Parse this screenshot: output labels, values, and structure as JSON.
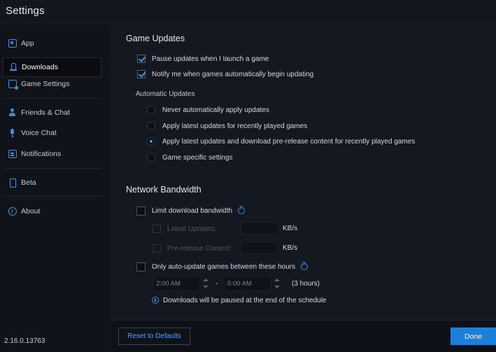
{
  "window": {
    "title": "Settings"
  },
  "sidebar": {
    "items": [
      {
        "label": "App",
        "icon": "app-icon"
      },
      {
        "label": "Downloads",
        "icon": "download-icon",
        "active": true
      },
      {
        "label": "Game Settings",
        "icon": "game-settings-icon"
      },
      {
        "label": "Friends & Chat",
        "icon": "friends-icon"
      },
      {
        "label": "Voice Chat",
        "icon": "microphone-icon"
      },
      {
        "label": "Notifications",
        "icon": "notifications-icon"
      },
      {
        "label": "Beta",
        "icon": "beta-icon"
      },
      {
        "label": "About",
        "icon": "info-icon"
      }
    ],
    "version": "2.16.0.13763"
  },
  "game_updates": {
    "title": "Game Updates",
    "pause_updates": "Pause updates when I launch a game",
    "notify_updates": "Notify me when games automatically begin updating",
    "automatic_updates_label": "Automatic Updates",
    "options": [
      "Never automatically apply updates",
      "Apply latest updates for recently played games",
      "Apply latest updates and download pre-release content for recently played games",
      "Game specific settings"
    ],
    "selected_option": 2
  },
  "network": {
    "title": "Network Bandwidth",
    "limit_bandwidth": "Limit download bandwidth",
    "latest_updates_label": "Latest Updates:",
    "prerelease_label": "Pre-release Content:",
    "unit": "KB/s",
    "auto_update_hours": "Only auto-update games between these hours",
    "start_time": "2:00 AM",
    "end_time": "5:00 AM",
    "separator": "-",
    "duration": "(3 hours)",
    "schedule_note": "Downloads will be paused at the end of the schedule"
  },
  "footer": {
    "reset_label": "Reset to Defaults",
    "done_label": "Done"
  },
  "colors": {
    "accent": "#1e7fd8",
    "link": "#4fa3f5",
    "background": "#141820"
  }
}
